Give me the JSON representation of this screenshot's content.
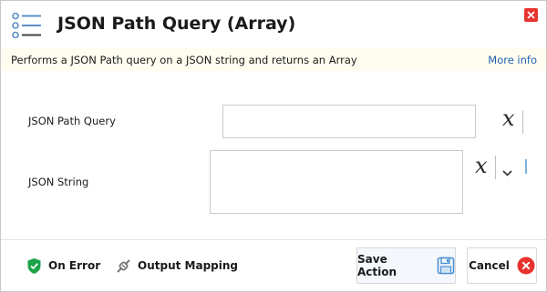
{
  "dialog": {
    "title": "JSON Path Query (Array)",
    "header_icon": "list-icon",
    "close_icon": "close-icon"
  },
  "description": {
    "text": "Performs a JSON Path query on a JSON string and returns an Array",
    "more_info_label": "More info"
  },
  "fields": {
    "json_path_query": {
      "label": "JSON Path Query",
      "value": "",
      "variable_glyph": "x"
    },
    "json_string": {
      "label": "JSON String",
      "value": "",
      "variable_glyph": "x"
    }
  },
  "footer": {
    "on_error_label": "On Error",
    "output_mapping_label": "Output Mapping",
    "save_label": "Save Action",
    "cancel_label": "Cancel"
  },
  "colors": {
    "close_red": "#e8322e",
    "shield_green": "#1fa34a",
    "link_blue": "#1f5fb4",
    "desc_bg": "#fffdf0",
    "save_blue": "#4a8fd0",
    "cancel_red": "#e8322e"
  }
}
